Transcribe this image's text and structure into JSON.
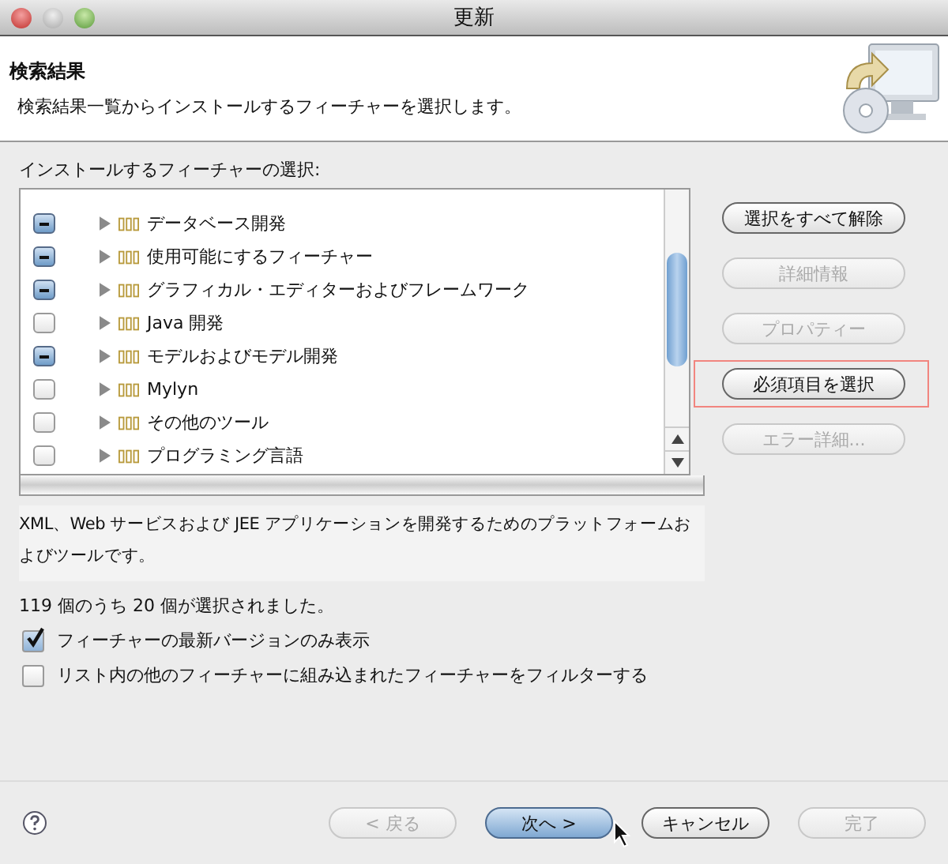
{
  "window": {
    "title": "更新"
  },
  "header": {
    "title": "検索結果",
    "description": "検索結果一覧からインストールするフィーチャーを選択します。"
  },
  "features": {
    "label": "インストールするフィーチャーの選択:",
    "items": [
      {
        "label": "データベース開発",
        "partial": true
      },
      {
        "label": "使用可能にするフィーチャー",
        "partial": true
      },
      {
        "label": "グラフィカル・エディターおよびフレームワーク",
        "partial": true
      },
      {
        "label": "Java 開発",
        "partial": false
      },
      {
        "label": "モデルおよびモデル開発",
        "partial": true
      },
      {
        "label": "Mylyn",
        "partial": false
      },
      {
        "label": "その他のツール",
        "partial": false
      },
      {
        "label": "プログラミング言語",
        "partial": false
      }
    ],
    "description": "XML、Web サービスおよび JEE アプリケーションを開発するためのプラットフォームおよびツールです。"
  },
  "side_buttons": [
    {
      "label": "選択をすべて解除",
      "disabled": false,
      "highlighted": false
    },
    {
      "label": "詳細情報",
      "disabled": true,
      "highlighted": false
    },
    {
      "label": "プロパティー",
      "disabled": true,
      "highlighted": false
    },
    {
      "label": "必須項目を選択",
      "disabled": false,
      "highlighted": true
    },
    {
      "label": "エラー詳細...",
      "disabled": true,
      "highlighted": false
    }
  ],
  "selection_status": "119 個のうち 20 個が選択されました。",
  "options": [
    {
      "label": "フィーチャーの最新バージョンのみ表示",
      "checked": true
    },
    {
      "label": "リスト内の他のフィーチャーに組み込まれたフィーチャーをフィルターする",
      "checked": false
    }
  ],
  "footer_buttons": [
    {
      "label": "< 戻る",
      "disabled": true,
      "default": false
    },
    {
      "label": "次へ >",
      "disabled": false,
      "default": true
    },
    {
      "label": "キャンセル",
      "disabled": false,
      "default": false
    },
    {
      "label": "完了",
      "disabled": true,
      "default": false
    }
  ]
}
